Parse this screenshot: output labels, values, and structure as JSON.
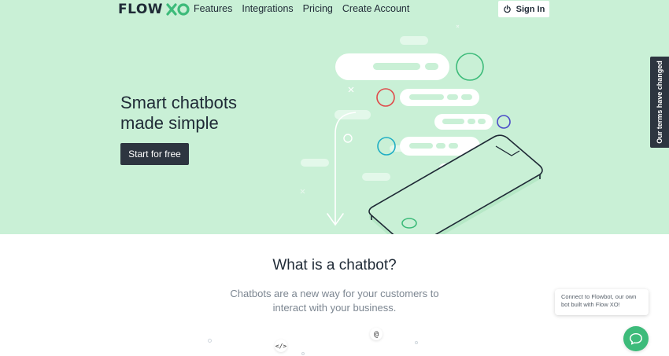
{
  "brand": {
    "logo_text": "FLOW",
    "logo_accent": "XO",
    "accent_color": "#3dbb7a",
    "text_color": "#1f2a36"
  },
  "nav": {
    "links": [
      "Features",
      "Integrations",
      "Pricing",
      "Create Account"
    ],
    "signin_label": "Sign In",
    "signin_icon": "power-icon"
  },
  "hero": {
    "headline_line1": "Smart chatbots",
    "headline_line2": "made simple",
    "cta_label": "Start for free",
    "background": "#c9f0d6"
  },
  "terms_tab": {
    "label": "Our terms have changed"
  },
  "section": {
    "title": "What is a chatbot?",
    "description": "Chatbots are a new way for your customers to interact with your business."
  },
  "chat_widget": {
    "bubble_text": "Connect to Flowbot, our own bot built with Flow XO!",
    "icon": "chat-bubble-icon"
  },
  "feature_icons": {
    "code_icon_text": "</>",
    "at_icon_text": "@"
  }
}
